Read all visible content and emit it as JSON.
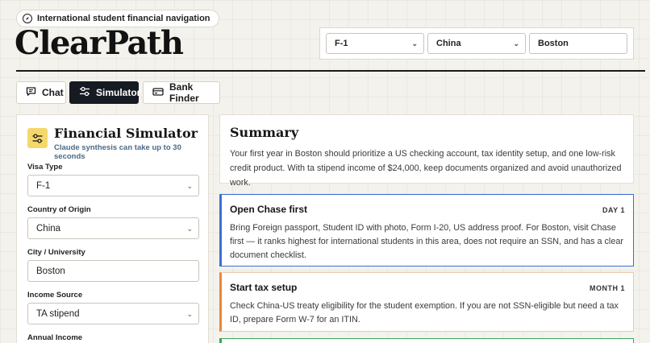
{
  "header": {
    "tagline": "International student financial navigation",
    "brand": "ClearPath",
    "visa_select": "F-1",
    "country_select": "China",
    "city_input": "Boston"
  },
  "tabs": [
    {
      "label": "Chat",
      "icon": "chat-icon"
    },
    {
      "label": "Simulator",
      "icon": "slider-icon",
      "active": true
    },
    {
      "label": "Bank Finder",
      "icon": "bank-card-icon"
    }
  ],
  "simulator": {
    "title": "Financial Simulator",
    "subtitle": "Claude synthesis can take up to 30 seconds",
    "fields": {
      "visa_type": {
        "label": "Visa Type",
        "value": "F-1"
      },
      "country": {
        "label": "Country of Origin",
        "value": "China"
      },
      "city": {
        "label": "City / University",
        "value": "Boston"
      },
      "income_source": {
        "label": "Income Source",
        "value": "TA stipend"
      },
      "annual_income": {
        "label": "Annual Income"
      }
    }
  },
  "summary": {
    "title": "Summary",
    "text": "Your first year in Boston should prioritize a US checking account, tax identity setup, and one low-risk credit product. With ta stipend income of $24,000, keep documents organized and avoid unauthorized work."
  },
  "steps": [
    {
      "title": "Open Chase first",
      "badge": "DAY 1",
      "text": "Bring Foreign passport, Student ID with photo, Form I-20, US address proof. For Boston, visit Chase first — it ranks highest for international students in this area, does not require an SSN, and has a clear document checklist.",
      "accent": "#3b6fd8"
    },
    {
      "title": "Start tax setup",
      "badge": "MONTH 1",
      "text": "Check China-US treaty eligibility for the student exemption. If you are not SSN-eligible but need a tax ID, prepare Form W-7 for an ITIN.",
      "accent": "#e8873a"
    }
  ],
  "colors": {
    "active_tab": "#161a22",
    "icon_tile": "#f5d86b",
    "step3_accent": "#3aa657"
  }
}
